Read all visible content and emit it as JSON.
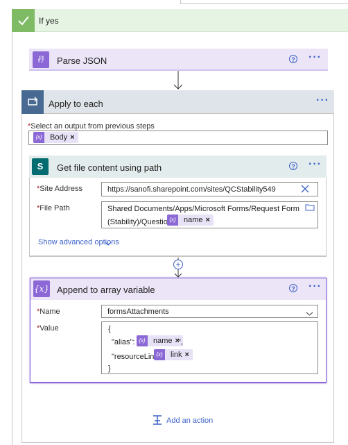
{
  "condition": {
    "title": "If yes"
  },
  "parse_json": {
    "title": "Parse JSON"
  },
  "apply_each": {
    "title": "Apply to each",
    "select_label": "Select an output from previous steps",
    "token": "Body"
  },
  "get_file": {
    "title": "Get file content using path",
    "site_label": "Site Address",
    "site_value": "https://sanofi.sharepoint.com/sites/QCStability549",
    "path_label": "File Path",
    "path_line1": "Shared Documents/Apps/Microsoft Forms/Request Form",
    "path_line2": "(Stability)/Question 1/",
    "path_token": "name",
    "advanced": "Show advanced options"
  },
  "append": {
    "title": "Append to array variable",
    "name_label": "Name",
    "name_value": "formsAttachments",
    "value_label": "Value",
    "open_brace": "{",
    "alias_text": "\"alias\": \"",
    "alias_token": "name",
    "alias_after": "\",",
    "link_text": "\"resourceLink\":",
    "link_token": "link",
    "close_brace": "}"
  },
  "add_action": "Add an action",
  "required_mark": "*",
  "colors": {
    "condition_green": "#7fba64",
    "parse_purple": "#8b68d6",
    "apply_blue": "#486991",
    "sharepoint_teal": "#036c70",
    "accent_blue": "#3b61c8"
  },
  "icons": [
    "check-icon",
    "json-icon",
    "loop-icon",
    "sharepoint-icon",
    "variable-icon",
    "help-icon",
    "more-icon",
    "arrow-down-icon",
    "plus-icon",
    "close-icon",
    "chevron-down-icon",
    "folder-icon",
    "add-action-icon"
  ]
}
